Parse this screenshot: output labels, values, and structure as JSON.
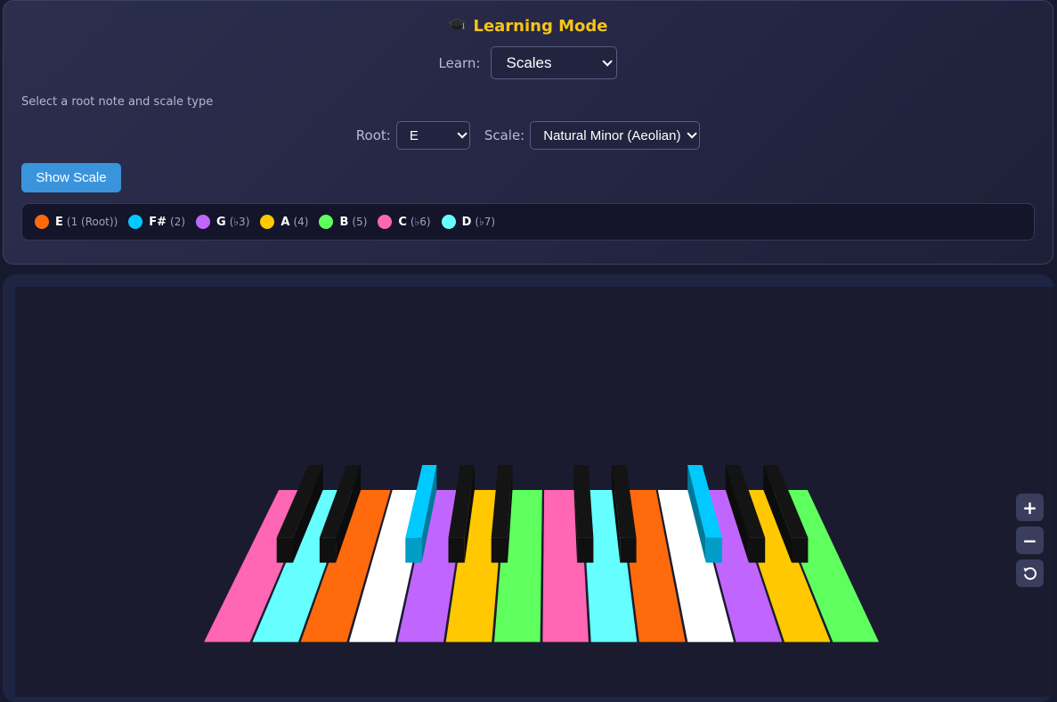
{
  "header": {
    "title": "Learning Mode",
    "icon": "graduation-cap-icon"
  },
  "learn": {
    "label": "Learn:",
    "selected": "Scales"
  },
  "hint": "Select a root note and scale type",
  "options": {
    "root_label": "Root:",
    "root_selected": "E",
    "scale_label": "Scale:",
    "scale_selected": "Natural Minor (Aeolian)"
  },
  "show_button": "Show Scale",
  "legend": [
    {
      "note": "E",
      "degree": "(1 (Root))",
      "color": "#ff6a0c"
    },
    {
      "note": "F#",
      "degree": "(2)",
      "color": "#00c9ff"
    },
    {
      "note": "G",
      "degree": "(♭3)",
      "color": "#c066ff"
    },
    {
      "note": "A",
      "degree": "(4)",
      "color": "#ffc800"
    },
    {
      "note": "B",
      "degree": "(5)",
      "color": "#5eff5e"
    },
    {
      "note": "C",
      "degree": "(♭6)",
      "color": "#ff66b3"
    },
    {
      "note": "D",
      "degree": "(♭7)",
      "color": "#66ffff"
    }
  ],
  "keyboard": {
    "white_keys": [
      "C",
      "D",
      "E",
      "F",
      "G",
      "A",
      "B",
      "C",
      "D",
      "E",
      "F",
      "G",
      "A",
      "B"
    ],
    "black_keys": [
      "C#",
      "D#",
      "F#",
      "G#",
      "A#",
      "C#",
      "D#",
      "F#",
      "G#",
      "A#"
    ],
    "highlight_colors": {
      "C": "#ff66b3",
      "D": "#66ffff",
      "E": "#ff6a0c",
      "F": "#ffffff",
      "G": "#c066ff",
      "A": "#ffc800",
      "B": "#5eff5e",
      "F#": "#00c9ff",
      "black": "#141414"
    }
  },
  "controls": {
    "zoom_in": "+",
    "zoom_out": "−",
    "reset_icon": "rotate-icon"
  }
}
